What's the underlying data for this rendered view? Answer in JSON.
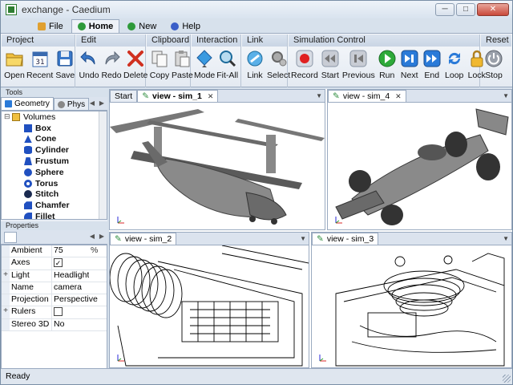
{
  "window": {
    "title": "exchange - Caedium"
  },
  "menu_tabs": [
    {
      "label": "File",
      "icon": "file-folder-icon",
      "color": "#e0a030"
    },
    {
      "label": "Home",
      "icon": "home-circle-icon",
      "color": "#2e9a3a"
    },
    {
      "label": "New",
      "icon": "new-circle-icon",
      "color": "#2e9a3a"
    },
    {
      "label": "Help",
      "icon": "help-circle-icon",
      "color": "#3a5ec8"
    }
  ],
  "ribbon": {
    "project": {
      "title": "Project",
      "open": "Open",
      "recent": "Recent",
      "save": "Save"
    },
    "edit": {
      "title": "Edit",
      "undo": "Undo",
      "redo": "Redo",
      "delete": "Delete"
    },
    "clipboard": {
      "title": "Clipboard",
      "copy": "Copy",
      "paste": "Paste"
    },
    "interaction": {
      "title": "Interaction",
      "mode": "Mode",
      "fit_all": "Fit-All"
    },
    "link": {
      "title": "Link",
      "link": "Link",
      "select": "Select"
    },
    "simulation": {
      "title": "Simulation Control",
      "record": "Record",
      "start": "Start",
      "previous": "Previous",
      "run": "Run",
      "next": "Next",
      "end": "End",
      "loop": "Loop",
      "lock": "Lock"
    },
    "reset": {
      "title": "Reset",
      "stop": "Stop"
    }
  },
  "tools": {
    "title": "Tools",
    "tabs": [
      "Geometry",
      "Phys"
    ],
    "tree_root": "Volumes",
    "items": [
      "Box",
      "Cone",
      "Cylinder",
      "Frustum",
      "Sphere",
      "Torus",
      "Stitch",
      "Chamfer",
      "Fillet"
    ]
  },
  "properties": {
    "title": "Properties",
    "rows": [
      {
        "name": "Ambient",
        "value": "75",
        "unit": "%",
        "expand": ""
      },
      {
        "name": "Axes",
        "value": "",
        "check": "✓",
        "expand": ""
      },
      {
        "name": "Light",
        "value": "Headlight",
        "unit": "",
        "expand": "+"
      },
      {
        "name": "Name",
        "value": "camera",
        "unit": "",
        "expand": ""
      },
      {
        "name": "Projection",
        "value": "Perspective",
        "unit": "",
        "expand": ""
      },
      {
        "name": "Rulers",
        "value": "",
        "check": " ",
        "expand": "+"
      },
      {
        "name": "Stereo 3D",
        "value": "No",
        "unit": "",
        "expand": ""
      }
    ]
  },
  "views": {
    "start_tab": "Start",
    "sim_1": "view - sim_1",
    "sim_4": "view - sim_4",
    "sim_2": "view - sim_2",
    "sim_3": "view - sim_3"
  },
  "status": {
    "text": "Ready"
  }
}
